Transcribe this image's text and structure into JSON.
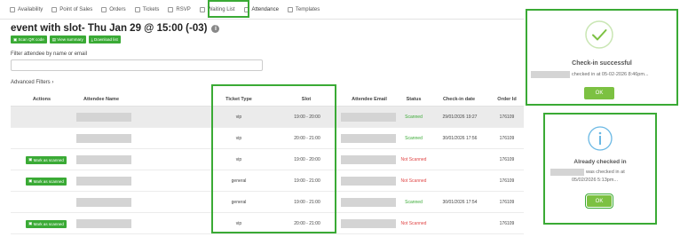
{
  "tabs": [
    {
      "label": "Availability",
      "icon": "calendar-icon"
    },
    {
      "label": "Point of Sales",
      "icon": "pos-icon"
    },
    {
      "label": "Orders",
      "icon": "cart-icon"
    },
    {
      "label": "Tickets",
      "icon": "ticket-icon"
    },
    {
      "label": "RSVP",
      "icon": "rsvp-icon"
    },
    {
      "label": "Waiting List",
      "icon": "list-icon"
    },
    {
      "label": "Attendance",
      "icon": "attendance-icon"
    },
    {
      "label": "Templates",
      "icon": "template-icon"
    }
  ],
  "page": {
    "title": "event with slot- Thu Jan 29 @ 15:00 (-03)",
    "buttons": [
      "Scan QR code",
      "View summary",
      "Download list"
    ],
    "filter_label": "Filter attendee by name or email",
    "filter_placeholder": "",
    "advanced_filters": "Advanced Filters",
    "advanced_chevron": "›"
  },
  "table": {
    "headers": [
      "Actions",
      "Attendee Name",
      "Ticket Type",
      "Slot",
      "Attendee Email",
      "Status",
      "Check-in date",
      "Order Id"
    ],
    "mark_label": "Mark as scanned",
    "rows": [
      {
        "action": false,
        "type": "vip",
        "slot": "19:00 - 20:00",
        "status": "Scanned",
        "checkin": "29/01/2026 19:27",
        "order": "176109"
      },
      {
        "action": false,
        "type": "vip",
        "slot": "20:00 - 21:00",
        "status": "Scanned",
        "checkin": "30/01/2026 17:56",
        "order": "176109"
      },
      {
        "action": true,
        "type": "vip",
        "slot": "19:00 - 20:00",
        "status": "Not Scanned",
        "checkin": "",
        "order": "176109"
      },
      {
        "action": true,
        "type": "general",
        "slot": "19:00 - 21:00",
        "status": "Not Scanned",
        "checkin": "",
        "order": "176109"
      },
      {
        "action": false,
        "type": "general",
        "slot": "19:00 - 21:00",
        "status": "Scanned",
        "checkin": "30/01/2026 17:54",
        "order": "176109"
      },
      {
        "action": true,
        "type": "vip",
        "slot": "20:00 - 21:00",
        "status": "Not Scanned",
        "checkin": "",
        "order": "176109"
      }
    ]
  },
  "dialog_success": {
    "title": "Check-in successful",
    "message": "checked in at 05-02-2026 8:46pm...",
    "ok": "OK",
    "icon": "check-circle-icon"
  },
  "dialog_already": {
    "title": "Already checked in",
    "message_line1": "was checked in at",
    "message_line2": "05/02/2026 5:13pm...",
    "ok": "OK",
    "icon": "info-circle-icon"
  },
  "colors": {
    "accent": "#3aaa35",
    "ok_button": "#7cc142",
    "danger": "#e04646",
    "info": "#6ab8e4"
  }
}
